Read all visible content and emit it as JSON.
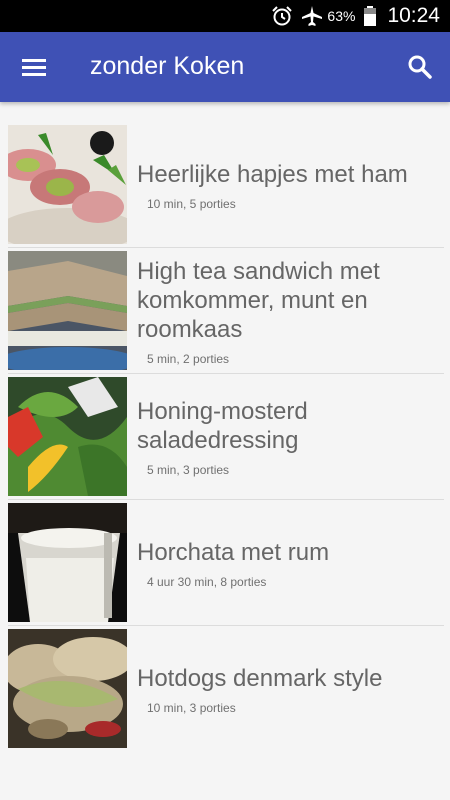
{
  "status": {
    "battery": "63%",
    "time": "10:24"
  },
  "header": {
    "title": "zonder Koken"
  },
  "recipes": [
    {
      "title": "Heerlijke hapjes met ham",
      "meta": "10 min, 5 porties"
    },
    {
      "title": "High tea sandwich met komkommer, munt en roomkaas",
      "meta": "5 min, 2 porties"
    },
    {
      "title": "Honing-mosterd saladedressing",
      "meta": "5 min, 3 porties"
    },
    {
      "title": "Horchata met rum",
      "meta": "4 uur 30 min, 8 porties"
    },
    {
      "title": "Hotdogs denmark style",
      "meta": "10 min, 3 porties"
    }
  ],
  "colors": {
    "primary": "#3f51b5",
    "background": "#f5f5f5",
    "title_text": "#666666"
  },
  "icons": {
    "menu": "menu-icon",
    "search": "search-icon",
    "alarm": "alarm-icon",
    "airplane": "airplane-mode-icon",
    "battery": "battery-icon"
  }
}
